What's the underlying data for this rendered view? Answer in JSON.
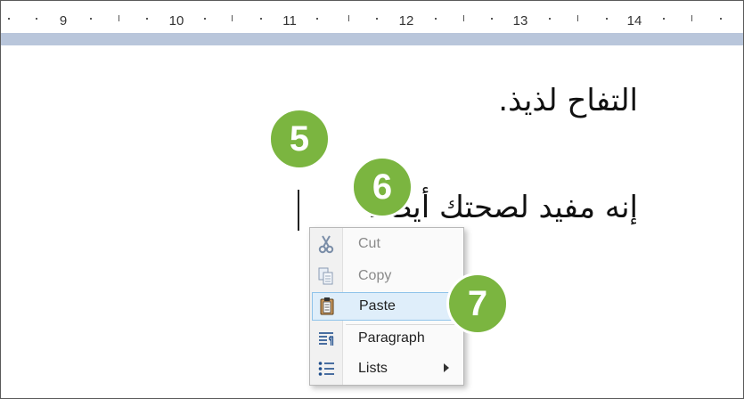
{
  "ruler": {
    "numbers": [
      "9",
      "10",
      "11",
      "12",
      "13",
      "14"
    ]
  },
  "document": {
    "line1": "التفاح لذيذ.",
    "line2": "إنه مفيد لصحتك أيضًا."
  },
  "context_menu": {
    "items": [
      {
        "label": "Cut",
        "icon": "scissors-icon",
        "enabled": false
      },
      {
        "label": "Copy",
        "icon": "copy-icon",
        "enabled": false
      },
      {
        "label": "Paste",
        "icon": "clipboard-icon",
        "enabled": true,
        "highlighted": true
      },
      {
        "label": "Paragraph",
        "icon": "paragraph-icon",
        "enabled": true
      },
      {
        "label": "Lists",
        "icon": "list-icon",
        "enabled": true,
        "submenu": true
      }
    ]
  },
  "callouts": {
    "step5": "5",
    "step6": "6",
    "step7": "7"
  },
  "colors": {
    "callout": "#7bb540",
    "menu_highlight": "#dfeefa",
    "ruler_band": "#b9c6db"
  }
}
